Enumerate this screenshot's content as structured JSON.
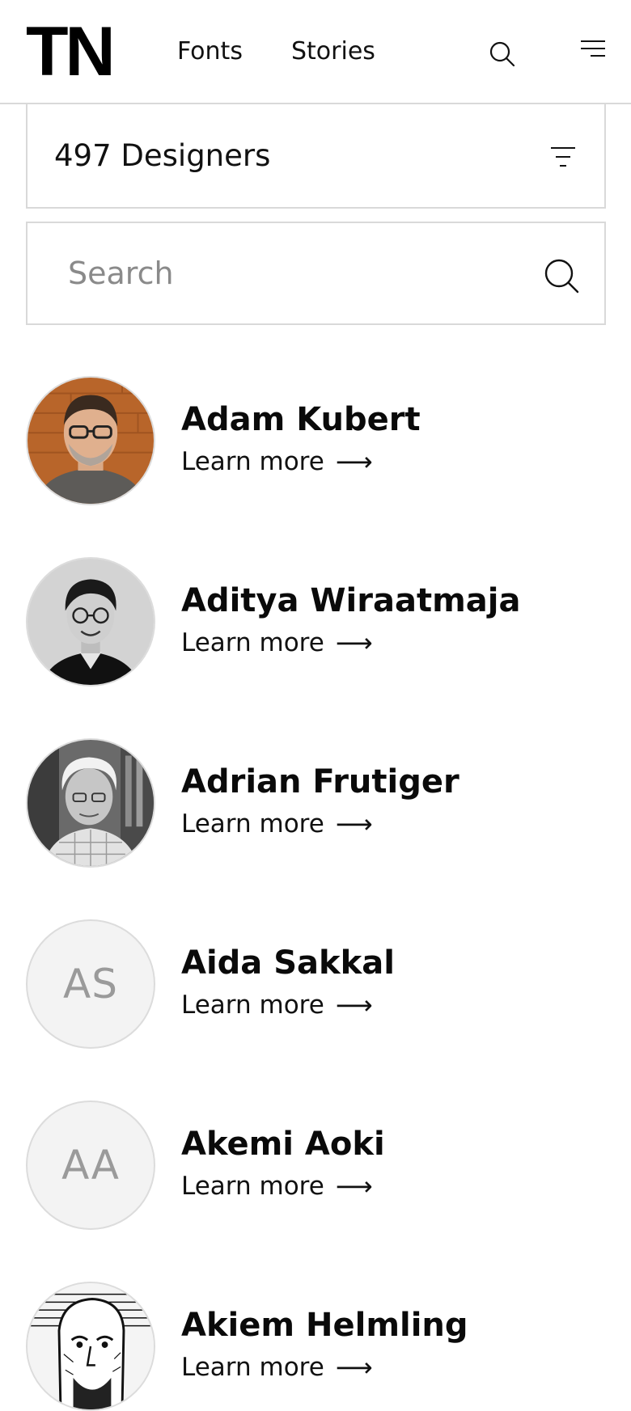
{
  "header": {
    "logo": "TN",
    "nav": [
      {
        "label": "Fonts"
      },
      {
        "label": "Stories"
      }
    ],
    "search_icon": "search-icon",
    "menu_icon": "hamburger-menu-icon"
  },
  "filter": {
    "count_label": "497 Designers",
    "icon": "filter-icon"
  },
  "search": {
    "placeholder": "Search",
    "value": "",
    "icon": "search-icon"
  },
  "designers": [
    {
      "name": "Adam Kubert",
      "link_label": "Learn more",
      "arrow": "⟶",
      "avatar": "photo"
    },
    {
      "name": "Aditya Wiraatmaja",
      "link_label": "Learn more",
      "arrow": "⟶",
      "avatar": "photo"
    },
    {
      "name": "Adrian Frutiger",
      "link_label": "Learn more",
      "arrow": "⟶",
      "avatar": "photo"
    },
    {
      "name": "Aida Sakkal",
      "link_label": "Learn more",
      "arrow": "⟶",
      "avatar": "initials",
      "initials": "AS"
    },
    {
      "name": "Akemi Aoki",
      "link_label": "Learn more",
      "arrow": "⟶",
      "avatar": "initials",
      "initials": "AA"
    },
    {
      "name": "Akiem Helmling",
      "link_label": "Learn more",
      "arrow": "⟶",
      "avatar": "photo"
    }
  ],
  "colors": {
    "text": "#0a0a0a",
    "border": "#d9d9d9",
    "placeholder": "#8a8a8a",
    "initials": "#9a9a9a",
    "initials_bg": "#f3f3f3"
  }
}
